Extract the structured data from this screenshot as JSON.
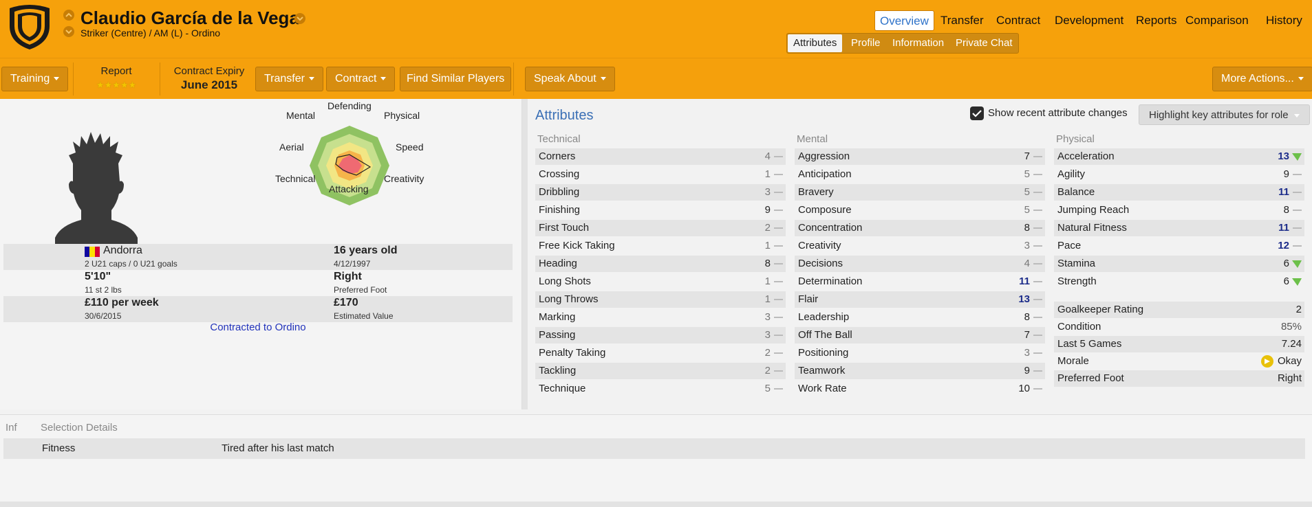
{
  "player": {
    "name": "Claudio García de la Vega",
    "position": "Striker (Centre) / AM (L) - Ordino"
  },
  "nav": {
    "tabs": [
      "Overview",
      "Transfer",
      "Contract",
      "Development",
      "Reports",
      "Comparison",
      "History"
    ],
    "active_tab": "Overview",
    "subtabs": [
      "Attributes",
      "Profile",
      "Information",
      "Private Chat"
    ],
    "active_subtab": "Attributes"
  },
  "toolbar": {
    "training": "Training",
    "report_label": "Report",
    "report_stars": 5,
    "contract_expiry_label": "Contract Expiry",
    "contract_expiry_value": "June 2015",
    "transfer": "Transfer",
    "contract": "Contract",
    "find_similar": "Find Similar Players",
    "speak_about": "Speak About",
    "more_actions": "More Actions..."
  },
  "radar": {
    "labels": {
      "defending": "Defending",
      "physical": "Physical",
      "speed": "Speed",
      "creativity": "Creativity",
      "attacking": "Attacking",
      "technical": "Technical",
      "aerial": "Aerial",
      "mental": "Mental"
    }
  },
  "profile": {
    "nation": "Andorra",
    "caps": "2 U21 caps / 0 U21 goals",
    "age": "16 years old",
    "dob": "4/12/1997",
    "height": "5'10\"",
    "weight": "11 st 2 lbs",
    "foot": "Right",
    "foot_label": "Preferred Foot",
    "wage": "£110 per week",
    "contract_end": "30/6/2015",
    "value": "£170",
    "value_label": "Estimated Value",
    "contracted": "Contracted to Ordino"
  },
  "attributes": {
    "title": "Attributes",
    "show_changes": "Show recent attribute changes",
    "highlight": "Highlight key attributes for role",
    "technical_label": "Technical",
    "mental_label": "Mental",
    "physical_label": "Physical",
    "technical": [
      {
        "name": "Corners",
        "value": "4"
      },
      {
        "name": "Crossing",
        "value": "1"
      },
      {
        "name": "Dribbling",
        "value": "3"
      },
      {
        "name": "Finishing",
        "value": "9"
      },
      {
        "name": "First Touch",
        "value": "2"
      },
      {
        "name": "Free Kick Taking",
        "value": "1"
      },
      {
        "name": "Heading",
        "value": "8"
      },
      {
        "name": "Long Shots",
        "value": "1"
      },
      {
        "name": "Long Throws",
        "value": "1"
      },
      {
        "name": "Marking",
        "value": "3"
      },
      {
        "name": "Passing",
        "value": "3"
      },
      {
        "name": "Penalty Taking",
        "value": "2"
      },
      {
        "name": "Tackling",
        "value": "2"
      },
      {
        "name": "Technique",
        "value": "5"
      }
    ],
    "mental": [
      {
        "name": "Aggression",
        "value": "7"
      },
      {
        "name": "Anticipation",
        "value": "5"
      },
      {
        "name": "Bravery",
        "value": "5"
      },
      {
        "name": "Composure",
        "value": "5"
      },
      {
        "name": "Concentration",
        "value": "8"
      },
      {
        "name": "Creativity",
        "value": "3"
      },
      {
        "name": "Decisions",
        "value": "4"
      },
      {
        "name": "Determination",
        "value": "11"
      },
      {
        "name": "Flair",
        "value": "13"
      },
      {
        "name": "Leadership",
        "value": "8"
      },
      {
        "name": "Off The Ball",
        "value": "7"
      },
      {
        "name": "Positioning",
        "value": "3"
      },
      {
        "name": "Teamwork",
        "value": "9"
      },
      {
        "name": "Work Rate",
        "value": "10"
      }
    ],
    "physical": [
      {
        "name": "Acceleration",
        "value": "13",
        "change": "up"
      },
      {
        "name": "Agility",
        "value": "9",
        "change": "none"
      },
      {
        "name": "Balance",
        "value": "11",
        "change": "none"
      },
      {
        "name": "Jumping Reach",
        "value": "8",
        "change": "none"
      },
      {
        "name": "Natural Fitness",
        "value": "11",
        "change": "none"
      },
      {
        "name": "Pace",
        "value": "12",
        "change": "none"
      },
      {
        "name": "Stamina",
        "value": "6",
        "change": "up"
      },
      {
        "name": "Strength",
        "value": "6",
        "change": "up"
      }
    ]
  },
  "stats": {
    "gk_label": "Goalkeeper Rating",
    "gk_value": "2",
    "condition_label": "Condition",
    "condition_value": "85%",
    "last5_label": "Last 5 Games",
    "last5_value": "7.24",
    "morale_label": "Morale",
    "morale_value": "Okay",
    "foot_label": "Preferred Foot",
    "foot_value": "Right"
  },
  "selection": {
    "inf_label": "Inf",
    "details_label": "Selection Details",
    "fitness_label": "Fitness",
    "fitness_value": "Tired after his last match"
  },
  "colors": {
    "header_orange": "#f6a10b",
    "button_brown": "#d78d10",
    "value_blue": "#1c2c8a",
    "title_blue": "#3a6fb5",
    "increase_green": "#6cc04a"
  }
}
